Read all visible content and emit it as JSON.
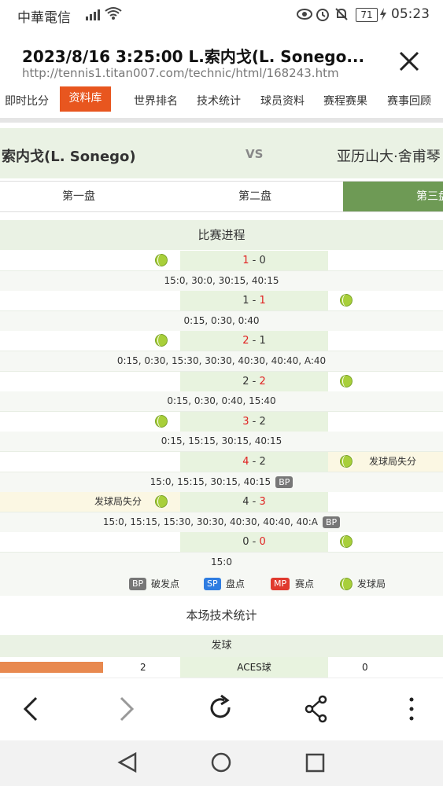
{
  "status_bar": {
    "carrier": "中華電信",
    "battery": "71",
    "time": "05:23"
  },
  "header": {
    "title": "2023/8/16 3:25:00 L.索内戈(L. Sonego...",
    "url": "http://tennis1.titan007.com/technic/html/168243.htm"
  },
  "nav": {
    "items": [
      "即时比分",
      "资料库",
      "世界排名",
      "技术统计",
      "球员资料",
      "赛程赛果",
      "赛事回顾"
    ]
  },
  "match": {
    "player1": "索内戈(L. Sonego)",
    "vs": "VS",
    "player2": "亚历山大·舍甫琴"
  },
  "set_tabs": [
    "第一盘",
    "第二盘",
    "第三盘"
  ],
  "progress": {
    "title": "比赛进程",
    "games": [
      {
        "score_left": "1",
        "score_right": "0",
        "red": "left",
        "server": "left",
        "points": "15:0, 30:0, 30:15, 40:15",
        "bp": false,
        "loss": ""
      },
      {
        "score_left": "1",
        "score_right": "1",
        "red": "right",
        "server": "right",
        "points": "0:15, 0:30, 0:40",
        "bp": false,
        "loss": ""
      },
      {
        "score_left": "2",
        "score_right": "1",
        "red": "left",
        "server": "left",
        "points": "0:15, 0:30, 15:30, 30:30, 40:30, 40:40, A:40",
        "bp": false,
        "loss": ""
      },
      {
        "score_left": "2",
        "score_right": "2",
        "red": "right",
        "server": "right",
        "points": "0:15, 0:30, 0:40, 15:40",
        "bp": false,
        "loss": ""
      },
      {
        "score_left": "3",
        "score_right": "2",
        "red": "left",
        "server": "left",
        "points": "0:15, 15:15, 30:15, 40:15",
        "bp": false,
        "loss": ""
      },
      {
        "score_left": "4",
        "score_right": "2",
        "red": "left",
        "server": "right",
        "points": "15:0, 15:15, 30:15, 40:15",
        "bp": true,
        "loss": "right"
      },
      {
        "score_left": "4",
        "score_right": "3",
        "red": "right",
        "server": "left",
        "points": "15:0, 15:15, 15:30, 30:30, 40:30, 40:40, 40:A",
        "bp": true,
        "loss": "left"
      },
      {
        "score_left": "0",
        "score_right": "0",
        "red": "right",
        "server": "right",
        "points": "15:0",
        "bp": false,
        "loss": ""
      }
    ],
    "loss_label": "发球局失分",
    "bp_label": "BP"
  },
  "legend": {
    "bp": "BP",
    "bp_text": "破发点",
    "sp": "SP",
    "sp_text": "盘点",
    "mp": "MP",
    "mp_text": "赛点",
    "serve_text": "发球局",
    "colors": {
      "bp": "#777777",
      "sp": "#2f7de1",
      "mp": "#e03a2e"
    }
  },
  "stats": {
    "title": "本场技术统计",
    "section": "发球",
    "aces_label": "ACES球",
    "aces_left": "2",
    "aces_right": "0"
  }
}
